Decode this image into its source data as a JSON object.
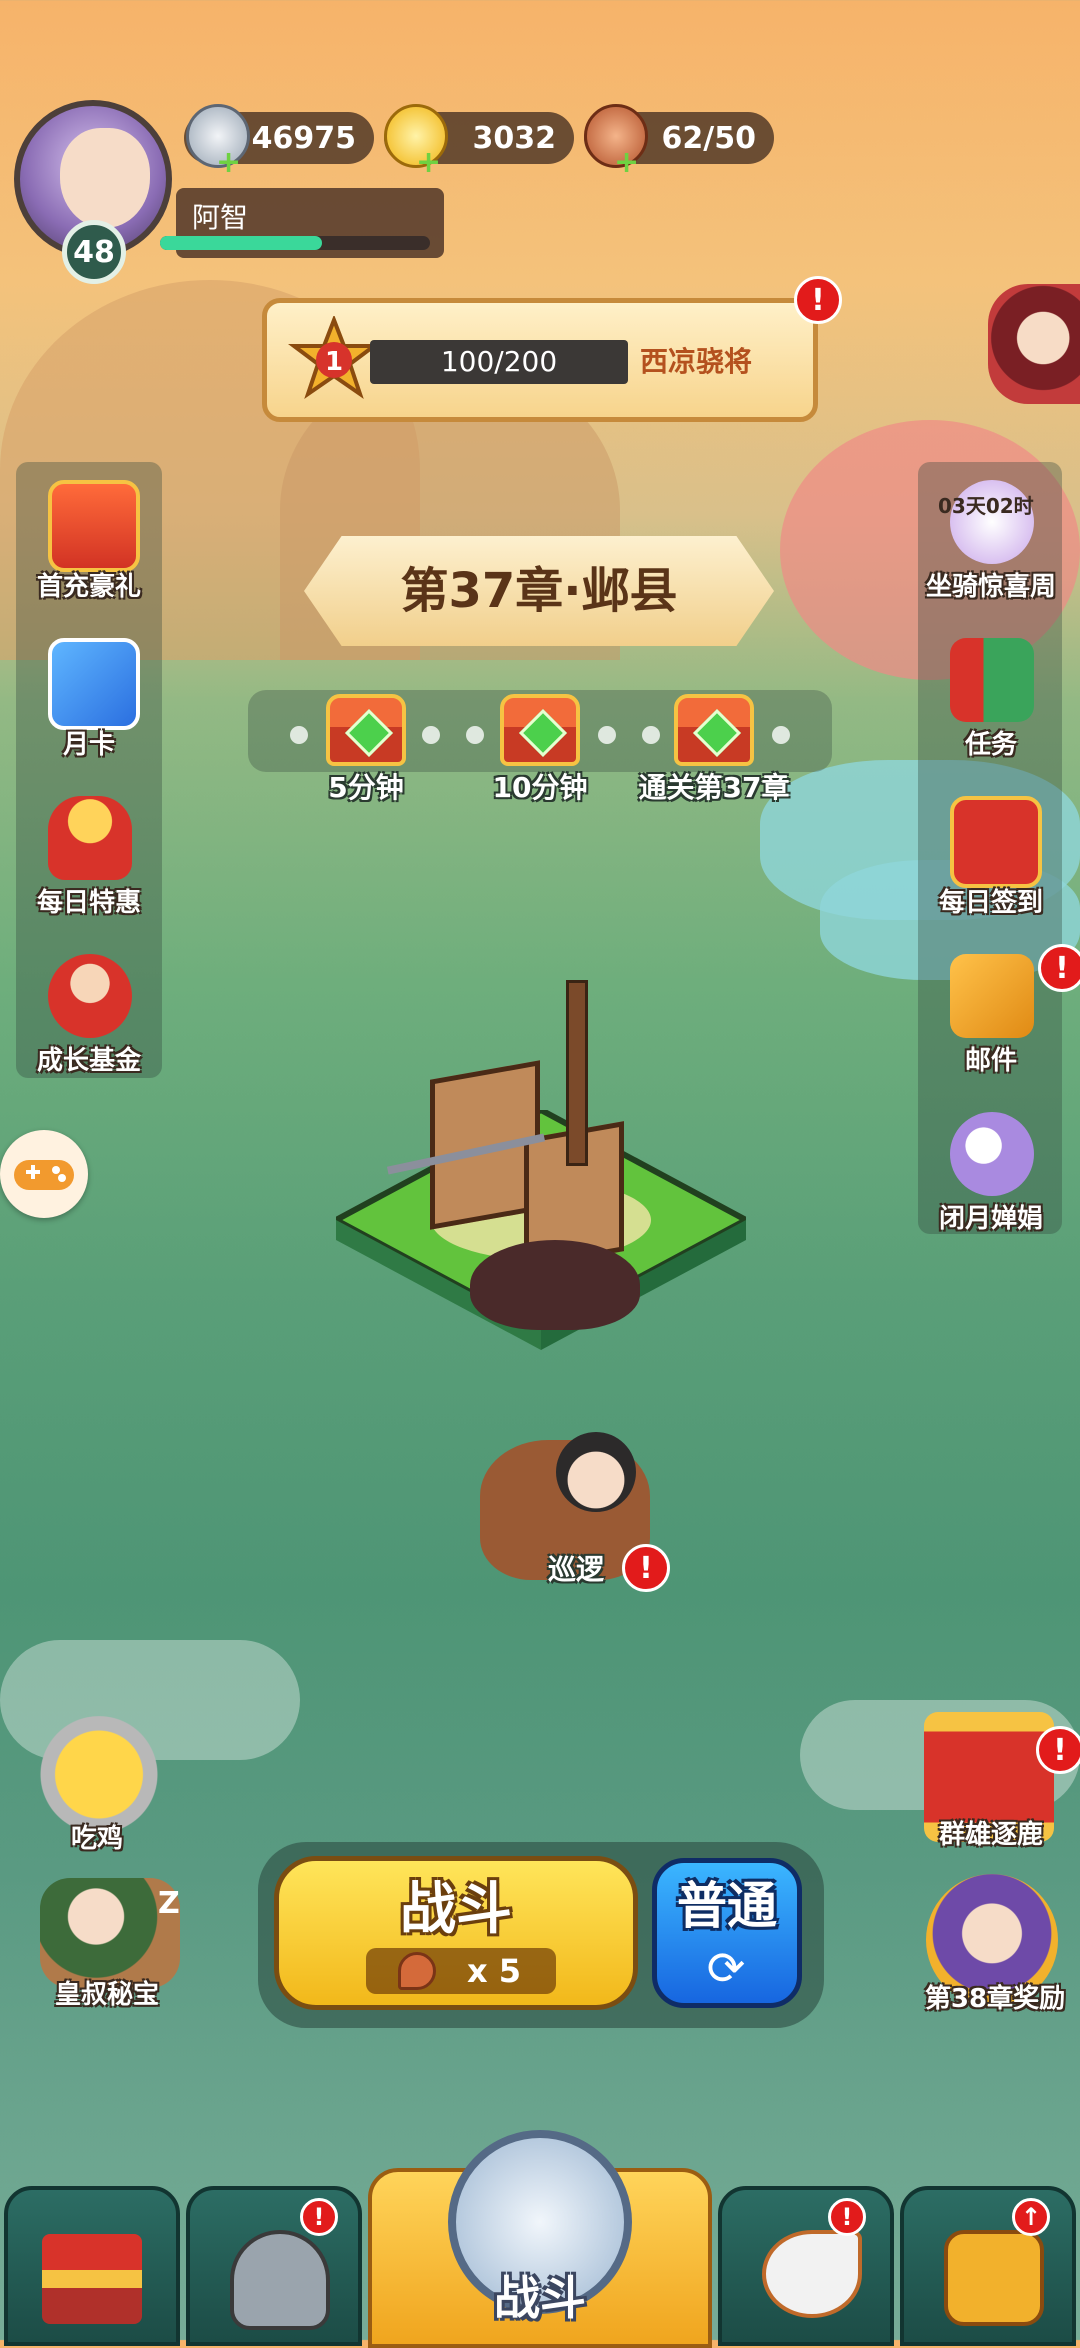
{
  "player": {
    "level": "48",
    "name": "阿智",
    "exp_fraction": 0.6
  },
  "resources": [
    {
      "icon": "silver-coin-icon",
      "value": "46975"
    },
    {
      "icon": "gold-ingot-icon",
      "value": "3032"
    },
    {
      "icon": "meat-stamina-icon",
      "value": "62/50"
    }
  ],
  "rank": {
    "progress": "100/200",
    "title": "西凉骁将",
    "alert": "!"
  },
  "left_menu": [
    {
      "label": "首充豪礼",
      "icon": "treasure-chest-icon"
    },
    {
      "label": "月卡",
      "icon": "monthly-card-icon"
    },
    {
      "label": "每日特惠",
      "icon": "gift-bag-icon"
    },
    {
      "label": "成长基金",
      "icon": "fortune-god-icon"
    }
  ],
  "right_menu": [
    {
      "label": "坐骑惊喜周",
      "icon": "mount-event-icon",
      "timer": "03天02时"
    },
    {
      "label": "任务",
      "icon": "scroll-icon"
    },
    {
      "label": "每日签到",
      "icon": "sign-in-icon"
    },
    {
      "label": "邮件",
      "icon": "mail-icon"
    },
    {
      "label": "闭月婵娟",
      "icon": "moon-beauty-icon"
    }
  ],
  "chapter": {
    "title": "第37章·邺县",
    "chests": [
      {
        "label": "5分钟"
      },
      {
        "label": "10分钟"
      },
      {
        "label": "通关第37章"
      }
    ]
  },
  "scene": {
    "patrol_label": "巡逻"
  },
  "corner_events": {
    "left": [
      {
        "label": "吃鸡"
      },
      {
        "label": "皇叔秘宝",
        "sleep": "Z"
      }
    ],
    "right": [
      {
        "label": "群雄逐鹿"
      },
      {
        "label": "第38章奖励"
      }
    ]
  },
  "battle": {
    "label": "战斗",
    "cost": "x 5",
    "mode": "普通"
  },
  "bottom_nav": {
    "center_label": "战斗"
  },
  "colors": {
    "alert": "#e21b1b",
    "battle": "#f2b81a",
    "mode": "#1766e0",
    "exp": "#3ad89a"
  }
}
